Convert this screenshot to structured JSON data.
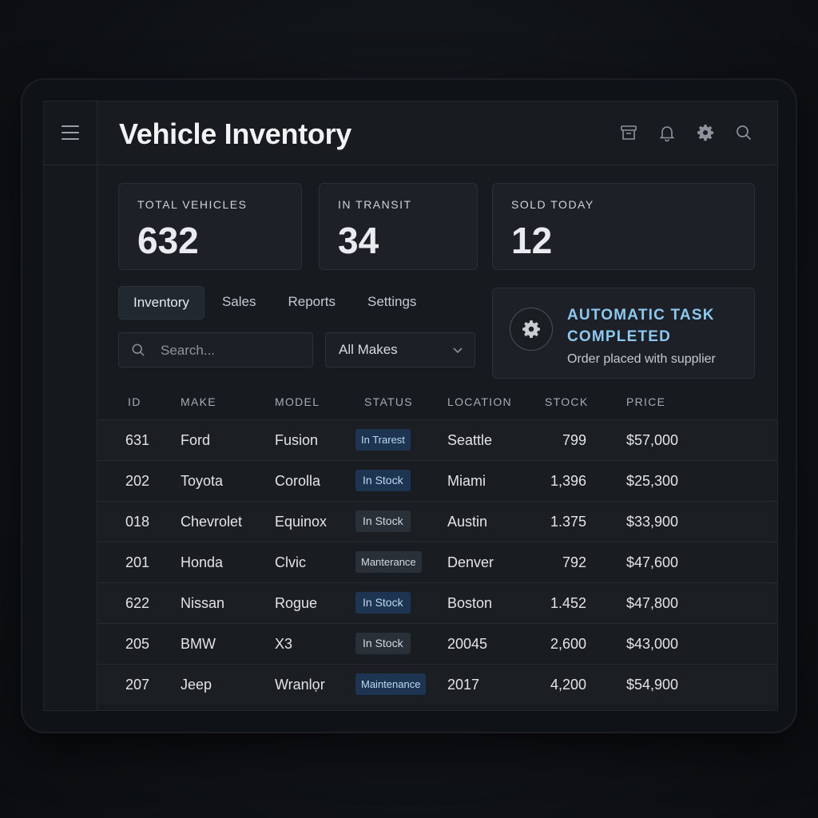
{
  "header": {
    "title": "Vehicle Inventory",
    "icons": [
      "archive-icon",
      "bell-icon",
      "gear-icon",
      "search-icon"
    ]
  },
  "stats": [
    {
      "label": "TOTAL VEHICLES",
      "value": "632"
    },
    {
      "label": "IN TRANSIT",
      "value": "34"
    },
    {
      "label": "SOLD TODAY",
      "value": "12"
    }
  ],
  "tabs": [
    {
      "label": "Inventory",
      "active": true
    },
    {
      "label": "Sales",
      "active": false
    },
    {
      "label": "Reports",
      "active": false
    },
    {
      "label": "Settings",
      "active": false
    }
  ],
  "search": {
    "placeholder": "Search..."
  },
  "make_filter": {
    "selected": "All Makes"
  },
  "notification": {
    "title": "AUTOMATIC TASK COMPLETED",
    "message": "Order placed with supplier"
  },
  "table": {
    "columns": [
      "ID",
      "MAKE",
      "MODEL",
      "STATUS",
      "LOCATION",
      "STOCK",
      "PRICE"
    ],
    "rows": [
      {
        "id": "631",
        "make": "Ford",
        "model": "Fusion",
        "status": "In Trarest",
        "location": "Seattle",
        "stock": "799",
        "price": "$57,000"
      },
      {
        "id": "202",
        "make": "Toyota",
        "model": "Corolla",
        "status": "In Stock",
        "location": "Miami",
        "stock": "1,396",
        "price": "$25,300"
      },
      {
        "id": "018",
        "make": "Chevrolet",
        "model": "Equinox",
        "status": "In Stock",
        "location": "Austin",
        "stock": "1.375",
        "price": "$33,900"
      },
      {
        "id": "201",
        "make": "Honda",
        "model": "Clvic",
        "status": "Manterance",
        "location": "Denver",
        "stock": "792",
        "price": "$47,600"
      },
      {
        "id": "622",
        "make": "Nissan",
        "model": "Rogue",
        "status": "In Stock",
        "location": "Boston",
        "stock": "1.452",
        "price": "$47,800"
      },
      {
        "id": "205",
        "make": "BMW",
        "model": "X3",
        "status": "In Stock",
        "location": "20045",
        "stock": "2,600",
        "price": "$43,000"
      },
      {
        "id": "207",
        "make": "Jeep",
        "model": "Wranlọr",
        "status": "Maintenance",
        "location": "2017",
        "stock": "4,200",
        "price": "$54,900"
      }
    ]
  },
  "colors": {
    "accent": "#8cc8ef",
    "badge_blue_bg": "#1d3550",
    "badge_blue_text": "#bcd8f2",
    "badge_gray_bg": "#2a3038",
    "badge_gray_text": "#d4d8dd"
  }
}
